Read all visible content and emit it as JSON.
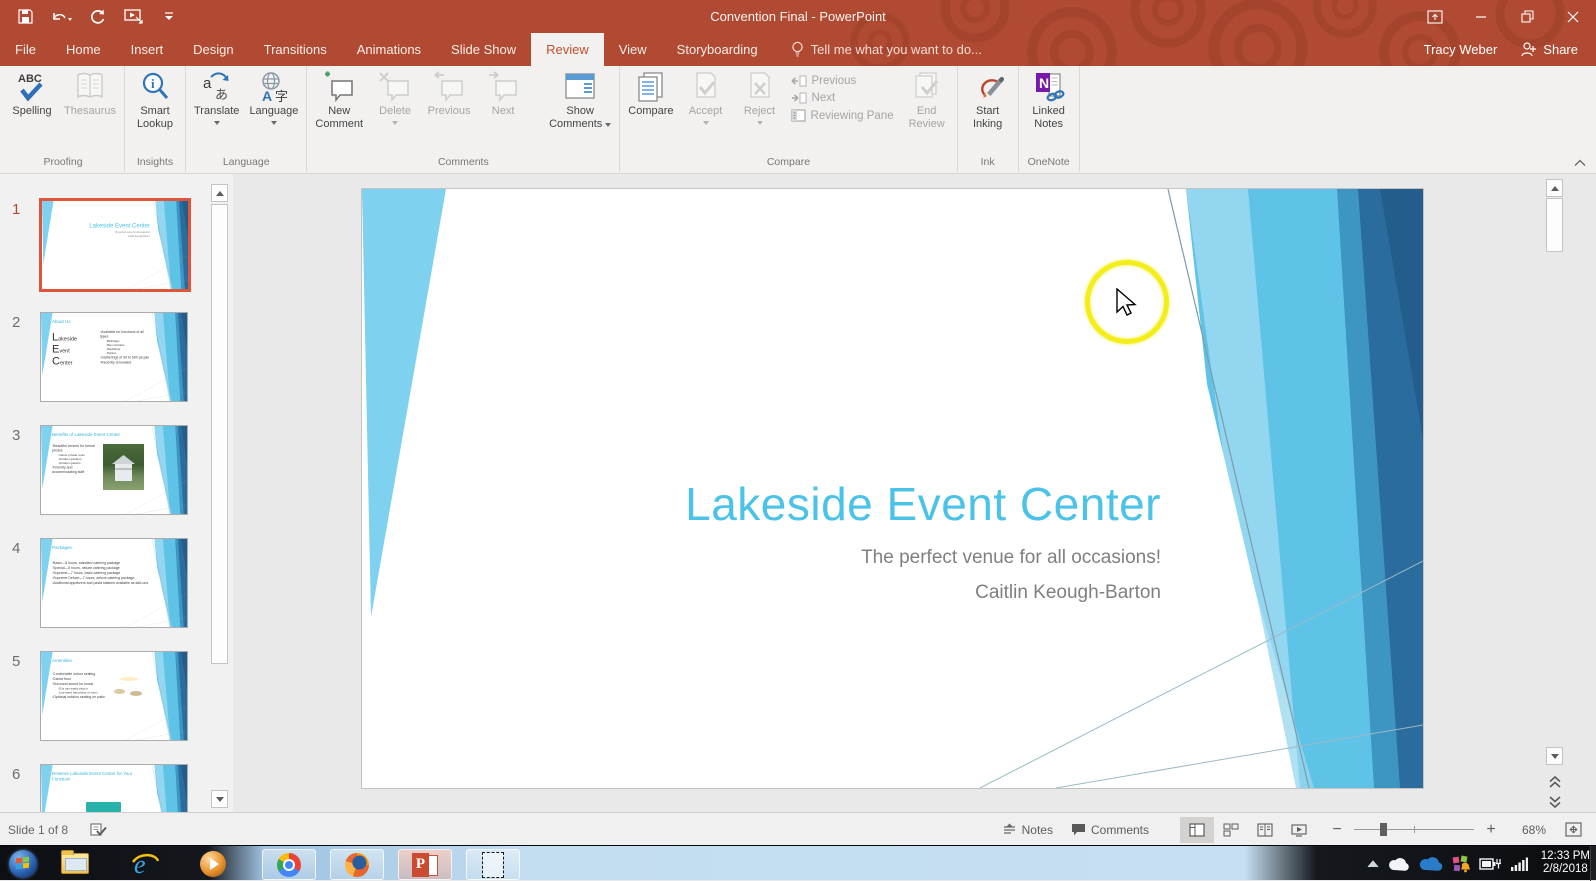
{
  "colors": {
    "titlebar_red": "#b04a32",
    "accent_red": "#b7472a",
    "ribbon_bg": "#f2f1f0",
    "slide_title_blue": "#4bc2e8",
    "thumb_selection": "#e0543a",
    "facet_light_blue": "#5fc3e7",
    "facet_mid_blue": "#3d95c1",
    "facet_dark_blue": "#2b6c9e",
    "click_ring_yellow": "#f3ed1a",
    "taskbar_blue": "#c3ddf1"
  },
  "header": {
    "title": "Convention Final - PowerPoint",
    "tell_me": "Tell me what you want to do...",
    "user": "Tracy Weber",
    "share_label": "Share"
  },
  "tabs": {
    "items": [
      {
        "label": "File"
      },
      {
        "label": "Home"
      },
      {
        "label": "Insert"
      },
      {
        "label": "Design"
      },
      {
        "label": "Transitions"
      },
      {
        "label": "Animations"
      },
      {
        "label": "Slide Show"
      },
      {
        "label": "Review"
      },
      {
        "label": "View"
      },
      {
        "label": "Storyboarding"
      }
    ],
    "active_tab": "Review"
  },
  "ribbon": {
    "groups": [
      {
        "label": "Proofing"
      },
      {
        "label": "Insights"
      },
      {
        "label": "Language"
      },
      {
        "label": "Comments"
      },
      {
        "label": "Compare"
      },
      {
        "label": "Ink"
      },
      {
        "label": "OneNote"
      }
    ],
    "buttons": {
      "spelling": {
        "l1": "Spelling"
      },
      "thesaurus": {
        "l1": "Thesaurus"
      },
      "smart_lookup": {
        "l1": "Smart",
        "l2": "Lookup"
      },
      "translate": {
        "l1": "Translate"
      },
      "language": {
        "l1": "Language"
      },
      "new_comment": {
        "l1": "New",
        "l2": "Comment"
      },
      "delete": {
        "l1": "Delete"
      },
      "previous_comment": {
        "l1": "Previous"
      },
      "next_comment": {
        "l1": "Next"
      },
      "show_comments": {
        "l1": "Show",
        "l2": "Comments"
      },
      "compare": {
        "l1": "Compare"
      },
      "accept": {
        "l1": "Accept"
      },
      "reject": {
        "l1": "Reject"
      },
      "previous_change": {
        "label": "Previous"
      },
      "next_change": {
        "label": "Next"
      },
      "reviewing_pane": {
        "label": "Reviewing Pane"
      },
      "end_review": {
        "l1": "End",
        "l2": "Review"
      },
      "start_inking": {
        "l1": "Start",
        "l2": "Inking"
      },
      "linked_notes": {
        "l1": "Linked",
        "l2": "Notes"
      }
    }
  },
  "slide": {
    "title": "Lakeside Event Center",
    "subtitle": "The perfect venue for all occasions!",
    "author": "Caitlin Keough-Barton"
  },
  "thumbnails": [
    {
      "num": "1",
      "title": "Lakeside Event Center",
      "line1": "The perfect venue for all occasions!",
      "line2": "Caitlin Keough-Barton"
    },
    {
      "num": "2",
      "heading": "About Us",
      "word1": "Lakeside",
      "word2": "Event",
      "word3": "Center",
      "b1": "Available for functions of all types",
      "s1": "Birthdays",
      "s2": "Bar mitzvahs",
      "s3": "Weddings",
      "s4": "Parties",
      "b2": "Gatherings of 30 to 500 people",
      "b3": "Recently renovated"
    },
    {
      "num": "3",
      "heading": "Benefits of Lakeside Event Center",
      "b1": "Beautiful venues for formal photos",
      "s1": "Indoor private room",
      "s2": "Outdoor gardens",
      "s3": "Outdoor gazebo",
      "b2": "Friendly and accommodating staff"
    },
    {
      "num": "4",
      "heading": "Packages",
      "b1": "Basic—5 hours, standard catering package",
      "b2": "Special—5 hours, deluxe catering package",
      "b3": "Supreme—7 hours, basic catering package",
      "b4": "Supreme Deluxe—7 hours, deluxe catering package",
      "b5": "Additional appetizers and pasta stations available as add-ons"
    },
    {
      "num": "5",
      "heading": "Amenities",
      "b1": "Comfortable indoor seating",
      "b2": "Dance floor",
      "b3": "Surround sound for music",
      "s1": "DJs can easily plug in",
      "s2": "Live band has plenty of room",
      "b4": "Optional outdoor seating on patio"
    },
    {
      "num": "6",
      "heading": "Reserve Lakeside Event Center for Your Function!"
    }
  ],
  "statusbar": {
    "slide_indicator": "Slide 1 of 8",
    "notes": "Notes",
    "comments": "Comments",
    "zoom": "68%"
  },
  "taskbar": {
    "time": "12:33 PM",
    "date": "2/8/2018"
  }
}
